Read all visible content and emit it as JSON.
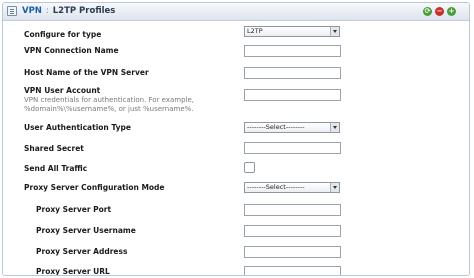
{
  "header": {
    "vpn_label": "VPN",
    "separator": ":",
    "page_title": "L2TP Profiles"
  },
  "form": {
    "configure_for_type": {
      "label": "Configure for type",
      "value": "L2TP"
    },
    "vpn_connection_name": {
      "label": "VPN Connection Name",
      "value": ""
    },
    "host_name": {
      "label": "Host Name of the VPN Server",
      "value": ""
    },
    "vpn_user_account": {
      "label": "VPN User Account",
      "help_line1": "VPN credentials for authentication. For example,",
      "help_line2": "%domain%\\%username%, or just %username%.",
      "value": ""
    },
    "user_auth_type": {
      "label": "User Authentication Type",
      "value": "--------Select--------"
    },
    "shared_secret": {
      "label": "Shared Secret",
      "value": ""
    },
    "send_all_traffic": {
      "label": "Send All Traffic",
      "checked": false
    },
    "proxy_config_mode": {
      "label": "Proxy Server Configuration Mode",
      "value": "--------Select--------"
    },
    "proxy_port": {
      "label": "Proxy Server Port",
      "value": ""
    },
    "proxy_username": {
      "label": "Proxy Server Username",
      "value": ""
    },
    "proxy_address": {
      "label": "Proxy Server Address",
      "value": ""
    },
    "proxy_url": {
      "label": "Proxy Server URL",
      "value": ""
    }
  },
  "icons": {
    "title": "list-icon",
    "refresh": "refresh-icon",
    "remove": "remove-icon",
    "add": "add-icon"
  }
}
